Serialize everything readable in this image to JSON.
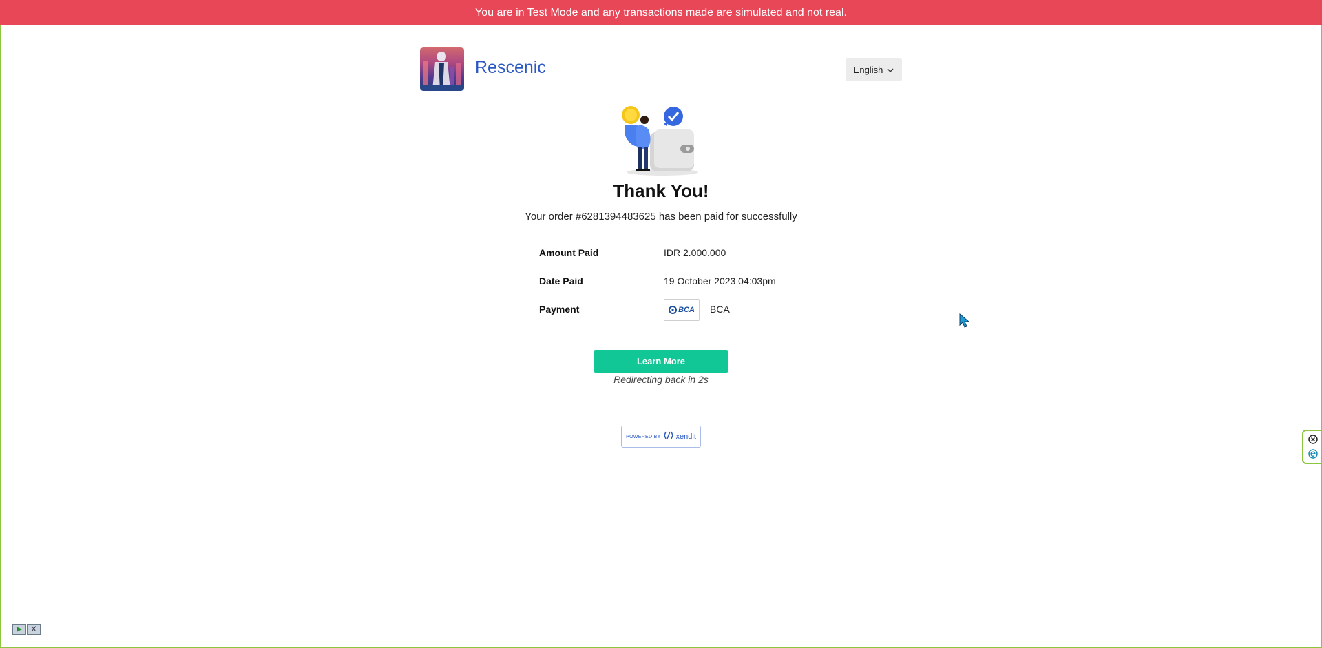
{
  "banner": {
    "text": "You are in Test Mode and any transactions made are simulated and not real."
  },
  "header": {
    "brand_name": "Rescenic",
    "language": "English"
  },
  "main": {
    "title": "Thank You!",
    "subtitle": "Your order #6281394483625 has been paid for successfully"
  },
  "details": {
    "amount_label": "Amount Paid",
    "amount_value": "IDR 2.000.000",
    "date_label": "Date Paid",
    "date_value": "19 October 2023 04:03pm",
    "payment_label": "Payment",
    "bank_logo_text": "BCA",
    "bank_name": "BCA"
  },
  "actions": {
    "learn_more": "Learn More",
    "redirect_text": "Redirecting back in 2s"
  },
  "footer": {
    "powered_small": "POWERED BY",
    "powered_brand": "xendit"
  },
  "bottom_widget": {
    "close_glyph": "X"
  },
  "colors": {
    "banner": "#e84757",
    "brand": "#2b59c3",
    "button": "#11c795",
    "frame": "#8cc63f"
  },
  "icons": [
    "chevron-down-icon",
    "wallet-illustration",
    "bca-logo",
    "xendit-logo",
    "mouse-cursor-icon",
    "close-circle-icon",
    "extension-e-icon",
    "play-icon",
    "close-icon"
  ]
}
